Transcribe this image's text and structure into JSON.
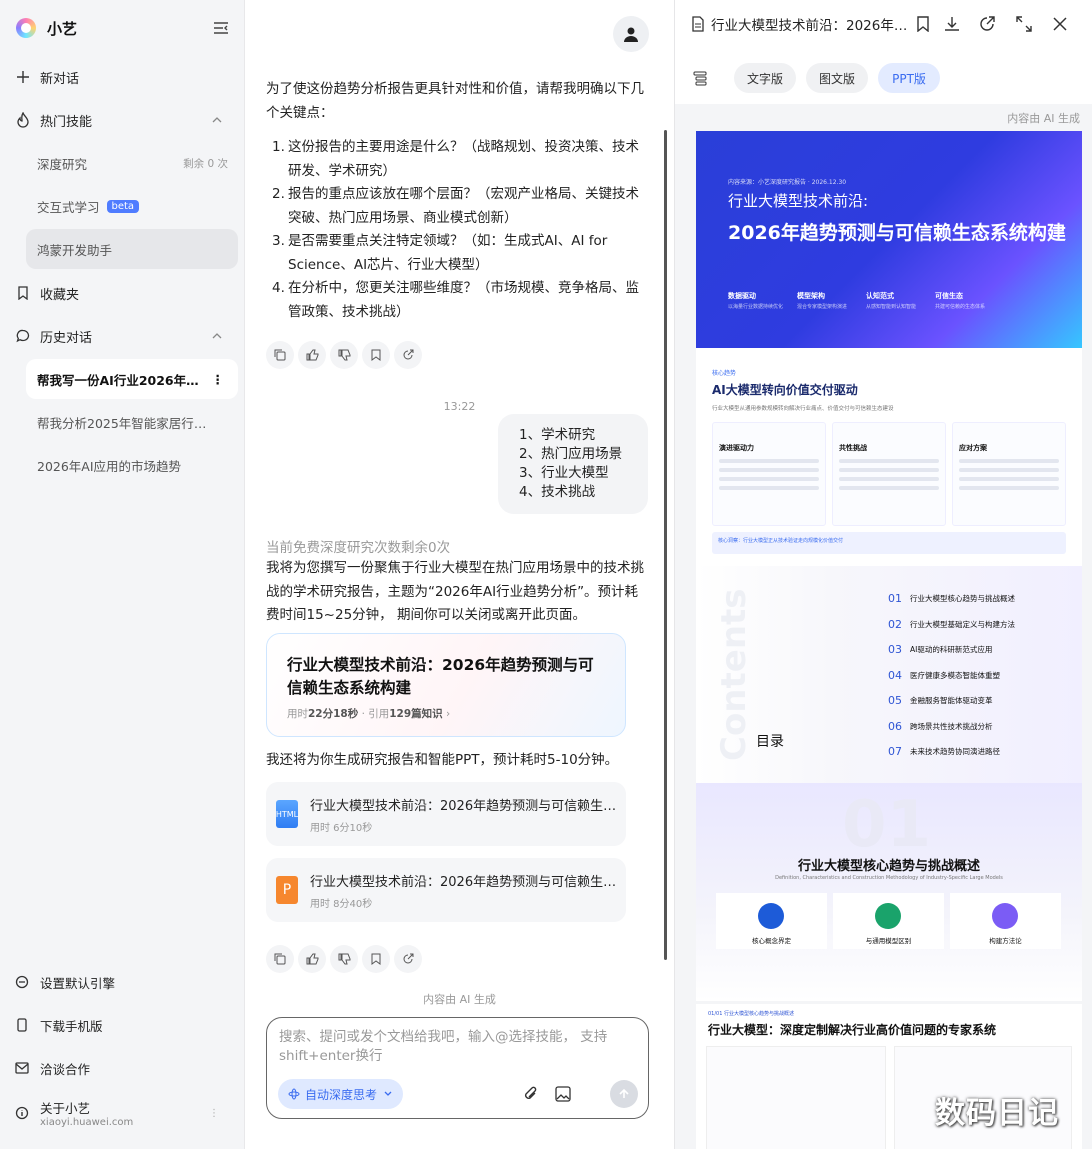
{
  "sidebar": {
    "app_name": "小艺",
    "new_chat": "新对话",
    "hot_skills": "热门技能",
    "skills": [
      {
        "label": "深度研究",
        "right": "剩余 0 次"
      },
      {
        "label": "交互式学习",
        "badge": "beta"
      },
      {
        "label": "鸿蒙开发助手"
      }
    ],
    "favorites": "收藏夹",
    "history_title": "历史对话",
    "history": [
      "帮我写一份AI行业2026年趋势分析报告",
      "帮我分析2025年智能家居行业的发展",
      "2026年AI应用的市场趋势"
    ],
    "history_more": "⋮",
    "footer": [
      "设置默认引擎",
      "下载手机版",
      "洽谈合作"
    ],
    "about": "关于小艺",
    "site": "xiaoyi.huawei.com"
  },
  "chat": {
    "intro": "为了使这份趋势分析报告更具针对性和价值，请帮我明确以下几个关键点：",
    "questions": [
      "这份报告的主要用途是什么？（战略规划、投资决策、技术研发、学术研究）",
      "报告的重点应该放在哪个层面？（宏观产业格局、关键技术突破、热门应用场景、商业模式创新）",
      "是否需要重点关注特定领域？（如：生成式AI、AI for Science、AI芯片、行业大模型）",
      "在分析中，您更关注哪些维度？（市场规模、竞争格局、监管政策、技术挑战）"
    ],
    "time": "13:22",
    "user_reply": [
      "1、学术研究",
      "2、热门应用场景",
      "3、行业大模型",
      "4、技术挑战"
    ],
    "notice": "当前免费深度研究次数剩余0次",
    "answer": "我将为您撰写一份聚焦于行业大模型在热门应用场景中的技术挑战的学术研究报告，主题为“2026年AI行业趋势分析”。预计耗费时间15~25分钟， 期间你可以关闭或离开此页面。",
    "report_card": {
      "title": "行业大模型技术前沿：2026年趋势预测与可信赖生态系统构建",
      "meta_prefix": "用时",
      "duration": "22分18秒",
      "meta_mid": " · 引用",
      "refs": "129篇知识",
      "arrow": "›"
    },
    "followup": "我还将为你生成研究报告和智能PPT，预计耗时5-10分钟。",
    "files": [
      {
        "type": "HTML",
        "title": "行业大模型技术前沿：2026年趋势预测与可信赖生态系统构建",
        "meta": "用时 6分10秒"
      },
      {
        "type": "P",
        "title": "行业大模型技术前沿：2026年趋势预测与可信赖生态系统构建",
        "meta": "用时 8分40秒"
      }
    ],
    "ai_note": "内容由 AI 生成",
    "input_placeholder": "搜索、提问或发个文档给我吧，输入@选择技能， 支持shift+enter换行",
    "mode": "自动深度思考"
  },
  "panel": {
    "title": "行业大模型技术前沿：2026年趋势预测与可信赖生态系统构建",
    "tabs": [
      "文字版",
      "图文版",
      "PPT版"
    ],
    "ai_note": "内容由 AI 生成",
    "slide1": {
      "small": "内容来源：小艺深度研究报告 · 2026.12.30",
      "h1": "行业大模型技术前沿:",
      "h2": "2026年趋势预测与可信赖生态系统构建",
      "features": [
        {
          "t": "数据驱动",
          "s": "以海量行业数据持续优化"
        },
        {
          "t": "模型架构",
          "s": "混合专家模型架构演进"
        },
        {
          "t": "认知范式",
          "s": "从感知智能到认知智能"
        },
        {
          "t": "可信生态",
          "s": "共建可信赖的生态体系"
        }
      ]
    },
    "slide2": {
      "k": "核心趋势",
      "h": "AI大模型转向价值交付驱动",
      "d": "行业大模型从通用参数规模转向解决行业痛点、价值交付与可信赖生态建设",
      "cols": [
        "演进驱动力",
        "共性挑战",
        "应对方案"
      ],
      "bar": "核心洞察：行业大模型正从技术验证走向规模化价值交付"
    },
    "slide3": {
      "big": "Contents",
      "label": "目录",
      "items": [
        {
          "n": "01",
          "t": "行业大模型核心趋势与挑战概述"
        },
        {
          "n": "02",
          "t": "行业大模型基础定义与构建方法"
        },
        {
          "n": "03",
          "t": "AI驱动的科研新范式应用"
        },
        {
          "n": "04",
          "t": "医疗健康多模态智能体重塑"
        },
        {
          "n": "05",
          "t": "金融服务智能体驱动变革"
        },
        {
          "n": "06",
          "t": "跨场景共性技术挑战分析"
        },
        {
          "n": "07",
          "t": "未来技术趋势协同演进路径"
        }
      ]
    },
    "slide4": {
      "num": "01",
      "h": "行业大模型核心趋势与挑战概述",
      "sub": "Definition, Characteristics and Construction Methodology of Industry-Specific Large Models",
      "boxes": [
        "核心概念界定",
        "与通用模型区别",
        "构建方法论"
      ]
    },
    "slide5": {
      "k": "01/01  行业大模型核心趋势与挑战概述",
      "h": "行业大模型：深度定制解决行业高价值问题的专家系统"
    }
  },
  "watermark": "数码日记",
  "colors": {
    "accent": "#3a6cf0",
    "html_file": "#2f7df3",
    "ppt_file": "#f6872e"
  }
}
